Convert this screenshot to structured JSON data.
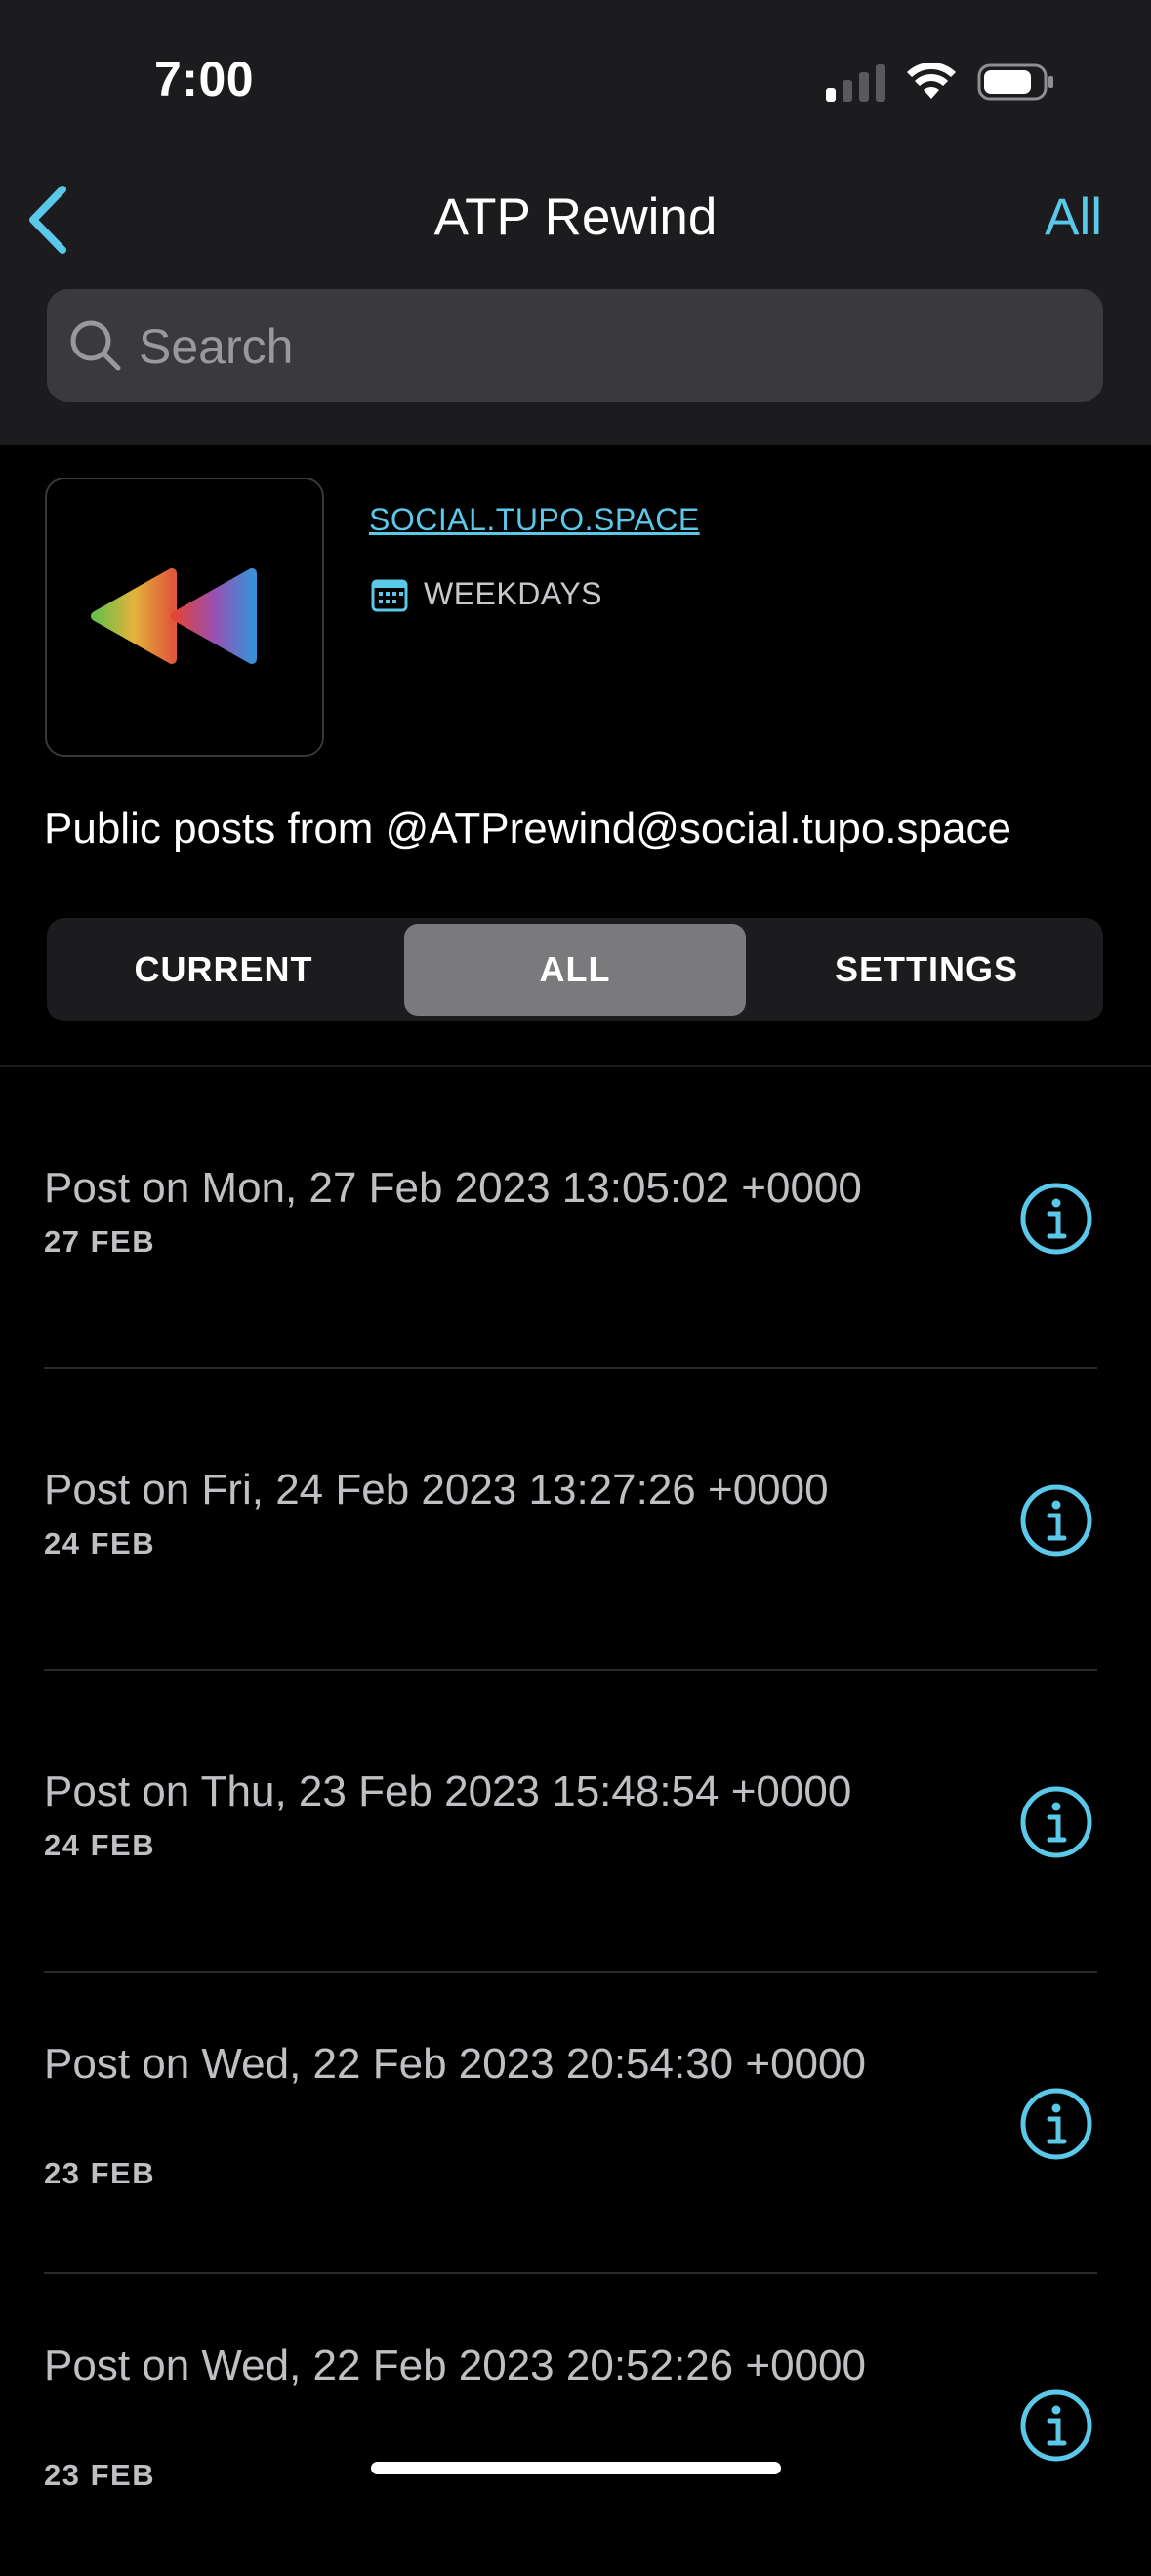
{
  "status": {
    "time": "7:00"
  },
  "nav": {
    "title": "ATP Rewind",
    "right_label": "All"
  },
  "search": {
    "placeholder": "Search"
  },
  "feed": {
    "server": "SOCIAL.TUPO.SPACE",
    "schedule": "WEEKDAYS",
    "description": "Public posts from @ATPrewind@social.tupo.space"
  },
  "tabs": [
    {
      "label": "CURRENT",
      "selected": false
    },
    {
      "label": "ALL",
      "selected": true
    },
    {
      "label": "SETTINGS",
      "selected": false
    }
  ],
  "posts": [
    {
      "title": "Post on Mon, 27 Feb 2023 13:05:02 +0000",
      "date": "27 FEB"
    },
    {
      "title": "Post on Fri, 24 Feb 2023 13:27:26 +0000",
      "date": "24 FEB"
    },
    {
      "title": "Post on Thu, 23 Feb 2023 15:48:54 +0000",
      "date": "24 FEB"
    },
    {
      "title": "Post on Wed, 22 Feb 2023 20:54:30 +0000",
      "date": "23 FEB"
    },
    {
      "title": "Post on Wed, 22 Feb 2023 20:52:26 +0000",
      "date": "23 FEB"
    }
  ],
  "colors": {
    "accent": "#5ac8e8",
    "background": "#000000",
    "bar": "#1c1c1e"
  }
}
